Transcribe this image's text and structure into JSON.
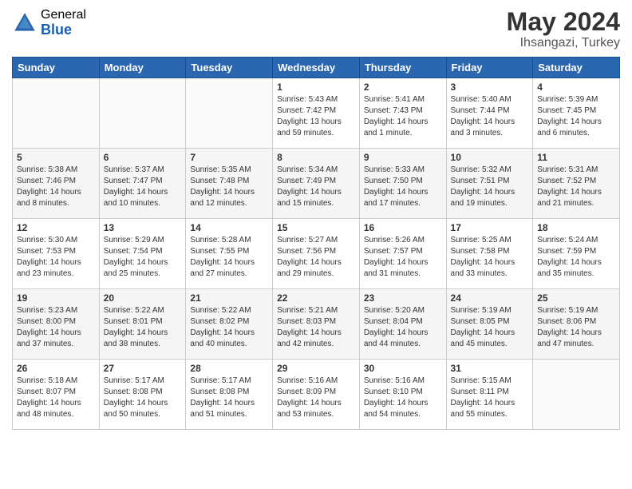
{
  "logo": {
    "general": "General",
    "blue": "Blue"
  },
  "title": {
    "month_year": "May 2024",
    "location": "Ihsangazi, Turkey"
  },
  "weekdays": [
    "Sunday",
    "Monday",
    "Tuesday",
    "Wednesday",
    "Thursday",
    "Friday",
    "Saturday"
  ],
  "weeks": [
    [
      {
        "day": "",
        "sunrise": "",
        "sunset": "",
        "daylight": ""
      },
      {
        "day": "",
        "sunrise": "",
        "sunset": "",
        "daylight": ""
      },
      {
        "day": "",
        "sunrise": "",
        "sunset": "",
        "daylight": ""
      },
      {
        "day": "1",
        "sunrise": "Sunrise: 5:43 AM",
        "sunset": "Sunset: 7:42 PM",
        "daylight": "Daylight: 13 hours and 59 minutes."
      },
      {
        "day": "2",
        "sunrise": "Sunrise: 5:41 AM",
        "sunset": "Sunset: 7:43 PM",
        "daylight": "Daylight: 14 hours and 1 minute."
      },
      {
        "day": "3",
        "sunrise": "Sunrise: 5:40 AM",
        "sunset": "Sunset: 7:44 PM",
        "daylight": "Daylight: 14 hours and 3 minutes."
      },
      {
        "day": "4",
        "sunrise": "Sunrise: 5:39 AM",
        "sunset": "Sunset: 7:45 PM",
        "daylight": "Daylight: 14 hours and 6 minutes."
      }
    ],
    [
      {
        "day": "5",
        "sunrise": "Sunrise: 5:38 AM",
        "sunset": "Sunset: 7:46 PM",
        "daylight": "Daylight: 14 hours and 8 minutes."
      },
      {
        "day": "6",
        "sunrise": "Sunrise: 5:37 AM",
        "sunset": "Sunset: 7:47 PM",
        "daylight": "Daylight: 14 hours and 10 minutes."
      },
      {
        "day": "7",
        "sunrise": "Sunrise: 5:35 AM",
        "sunset": "Sunset: 7:48 PM",
        "daylight": "Daylight: 14 hours and 12 minutes."
      },
      {
        "day": "8",
        "sunrise": "Sunrise: 5:34 AM",
        "sunset": "Sunset: 7:49 PM",
        "daylight": "Daylight: 14 hours and 15 minutes."
      },
      {
        "day": "9",
        "sunrise": "Sunrise: 5:33 AM",
        "sunset": "Sunset: 7:50 PM",
        "daylight": "Daylight: 14 hours and 17 minutes."
      },
      {
        "day": "10",
        "sunrise": "Sunrise: 5:32 AM",
        "sunset": "Sunset: 7:51 PM",
        "daylight": "Daylight: 14 hours and 19 minutes."
      },
      {
        "day": "11",
        "sunrise": "Sunrise: 5:31 AM",
        "sunset": "Sunset: 7:52 PM",
        "daylight": "Daylight: 14 hours and 21 minutes."
      }
    ],
    [
      {
        "day": "12",
        "sunrise": "Sunrise: 5:30 AM",
        "sunset": "Sunset: 7:53 PM",
        "daylight": "Daylight: 14 hours and 23 minutes."
      },
      {
        "day": "13",
        "sunrise": "Sunrise: 5:29 AM",
        "sunset": "Sunset: 7:54 PM",
        "daylight": "Daylight: 14 hours and 25 minutes."
      },
      {
        "day": "14",
        "sunrise": "Sunrise: 5:28 AM",
        "sunset": "Sunset: 7:55 PM",
        "daylight": "Daylight: 14 hours and 27 minutes."
      },
      {
        "day": "15",
        "sunrise": "Sunrise: 5:27 AM",
        "sunset": "Sunset: 7:56 PM",
        "daylight": "Daylight: 14 hours and 29 minutes."
      },
      {
        "day": "16",
        "sunrise": "Sunrise: 5:26 AM",
        "sunset": "Sunset: 7:57 PM",
        "daylight": "Daylight: 14 hours and 31 minutes."
      },
      {
        "day": "17",
        "sunrise": "Sunrise: 5:25 AM",
        "sunset": "Sunset: 7:58 PM",
        "daylight": "Daylight: 14 hours and 33 minutes."
      },
      {
        "day": "18",
        "sunrise": "Sunrise: 5:24 AM",
        "sunset": "Sunset: 7:59 PM",
        "daylight": "Daylight: 14 hours and 35 minutes."
      }
    ],
    [
      {
        "day": "19",
        "sunrise": "Sunrise: 5:23 AM",
        "sunset": "Sunset: 8:00 PM",
        "daylight": "Daylight: 14 hours and 37 minutes."
      },
      {
        "day": "20",
        "sunrise": "Sunrise: 5:22 AM",
        "sunset": "Sunset: 8:01 PM",
        "daylight": "Daylight: 14 hours and 38 minutes."
      },
      {
        "day": "21",
        "sunrise": "Sunrise: 5:22 AM",
        "sunset": "Sunset: 8:02 PM",
        "daylight": "Daylight: 14 hours and 40 minutes."
      },
      {
        "day": "22",
        "sunrise": "Sunrise: 5:21 AM",
        "sunset": "Sunset: 8:03 PM",
        "daylight": "Daylight: 14 hours and 42 minutes."
      },
      {
        "day": "23",
        "sunrise": "Sunrise: 5:20 AM",
        "sunset": "Sunset: 8:04 PM",
        "daylight": "Daylight: 14 hours and 44 minutes."
      },
      {
        "day": "24",
        "sunrise": "Sunrise: 5:19 AM",
        "sunset": "Sunset: 8:05 PM",
        "daylight": "Daylight: 14 hours and 45 minutes."
      },
      {
        "day": "25",
        "sunrise": "Sunrise: 5:19 AM",
        "sunset": "Sunset: 8:06 PM",
        "daylight": "Daylight: 14 hours and 47 minutes."
      }
    ],
    [
      {
        "day": "26",
        "sunrise": "Sunrise: 5:18 AM",
        "sunset": "Sunset: 8:07 PM",
        "daylight": "Daylight: 14 hours and 48 minutes."
      },
      {
        "day": "27",
        "sunrise": "Sunrise: 5:17 AM",
        "sunset": "Sunset: 8:08 PM",
        "daylight": "Daylight: 14 hours and 50 minutes."
      },
      {
        "day": "28",
        "sunrise": "Sunrise: 5:17 AM",
        "sunset": "Sunset: 8:08 PM",
        "daylight": "Daylight: 14 hours and 51 minutes."
      },
      {
        "day": "29",
        "sunrise": "Sunrise: 5:16 AM",
        "sunset": "Sunset: 8:09 PM",
        "daylight": "Daylight: 14 hours and 53 minutes."
      },
      {
        "day": "30",
        "sunrise": "Sunrise: 5:16 AM",
        "sunset": "Sunset: 8:10 PM",
        "daylight": "Daylight: 14 hours and 54 minutes."
      },
      {
        "day": "31",
        "sunrise": "Sunrise: 5:15 AM",
        "sunset": "Sunset: 8:11 PM",
        "daylight": "Daylight: 14 hours and 55 minutes."
      },
      {
        "day": "",
        "sunrise": "",
        "sunset": "",
        "daylight": ""
      }
    ]
  ]
}
